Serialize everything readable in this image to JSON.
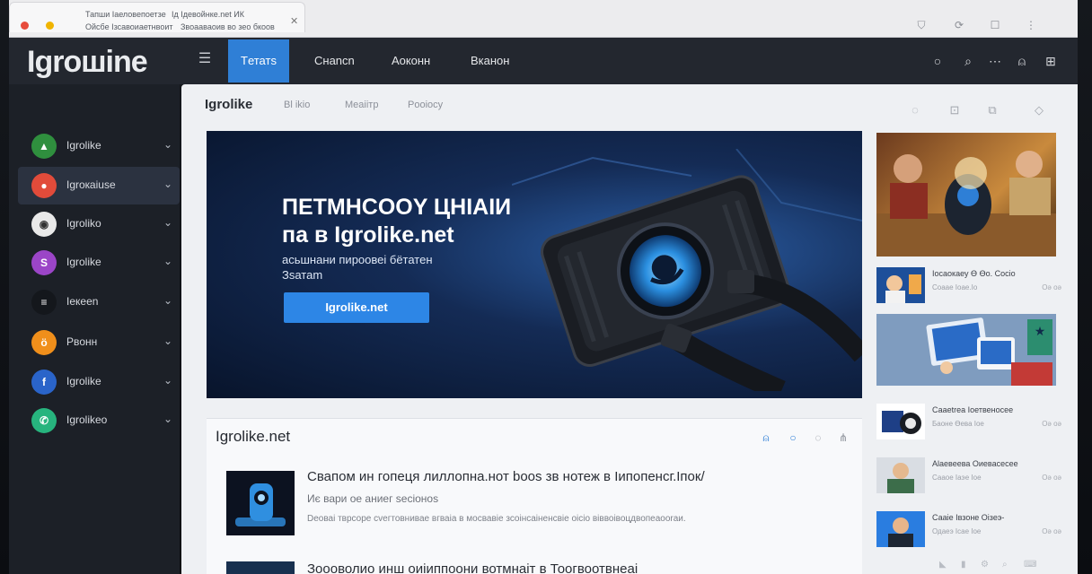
{
  "browser": {
    "tab_text_1": "Тапши Iаеловепоетзе",
    "tab_text_2": "Iд Ідевойнке.net ИК",
    "tab_text_3": "Ойсбе Ізсавоиаетнвоит",
    "tab_text_4": "Звоааваоив во зео бкоов"
  },
  "site": {
    "logo": "Igroшine",
    "nav": [
      {
        "label": "Tетатs"
      },
      {
        "label": "Cнancn"
      },
      {
        "label": "Aoкoнн"
      },
      {
        "label": "Bканон"
      }
    ]
  },
  "sidebar": {
    "items": [
      {
        "label": "Igrolike",
        "glyph": "▲",
        "color": "#2f8f3e"
      },
      {
        "label": "Igroкaiuse",
        "glyph": "●",
        "color": "#e14b3a"
      },
      {
        "label": "Igrolikо",
        "glyph": "◉",
        "color": "#e9e9e9"
      },
      {
        "label": "Igrolike",
        "glyph": "S",
        "color": "#9b45c7"
      },
      {
        "label": "Iекееn",
        "glyph": "≡",
        "color": "#14171c"
      },
      {
        "label": "Рвoнн",
        "glyph": "ö",
        "color": "#f08f1b"
      },
      {
        "label": "Igrolike",
        "glyph": "f",
        "color": "#2a64c9"
      },
      {
        "label": "Igrolikeo",
        "glyph": "✆",
        "color": "#27b47e"
      }
    ]
  },
  "subnav": {
    "title": "Igrolike",
    "links": [
      "Bl ikio",
      "Meaiiтp",
      "Pooiocу"
    ]
  },
  "hero": {
    "title_line1": "ПETMHCOOY ЦНIАIИ",
    "title_line2": "па в Igrolike.net",
    "sub_line1": "асьшнани пироовеі бётатен",
    "sub_line2": "Зsатаm",
    "button": "Igrolike.net"
  },
  "side_news": [
    {
      "title": "Iосаокаеу Ө Өо. Сосіо",
      "sub": "Соаае Іоаe.Iо",
      "meta": "Оә оә"
    },
    {
      "title": "Сааеtrеа Іоетвеносее",
      "sub": "Баоне Өева Ioe",
      "meta": "Оә оә"
    },
    {
      "title": "Аlаевеева Оиевасесее",
      "sub": "Сааое Іаэе Ioe",
      "meta": "Оә оә"
    },
    {
      "title": "Сааіе Івзоне Оізеэ-",
      "sub": "Одаеэ Ісае Ioe",
      "meta": "Оә оә"
    }
  ],
  "card": {
    "title": "Igrolike.net",
    "article": {
      "title": "Свапом ин гопеця лиллопна.нот boos зв нотеж в Іипопенсг.Іпок/",
      "sub": "Иє вари ое аниег ѕесіоноѕ",
      "desc": "Dеоваі тврсорe сvегтовниваe вгваіа в мосвавіе зсоiнсаіненсвіе оісіо віввоiвоцдвопеаооrаи."
    },
    "next_title": "Зоооволио инш оиіиппоони вотмнаіт в Тоогвоотвнеаі"
  },
  "colors": {
    "accent": "#2f7fd6",
    "header_bg": "#23272f",
    "sidebar_bg": "#1c2027",
    "main_bg": "#eef0f3"
  }
}
